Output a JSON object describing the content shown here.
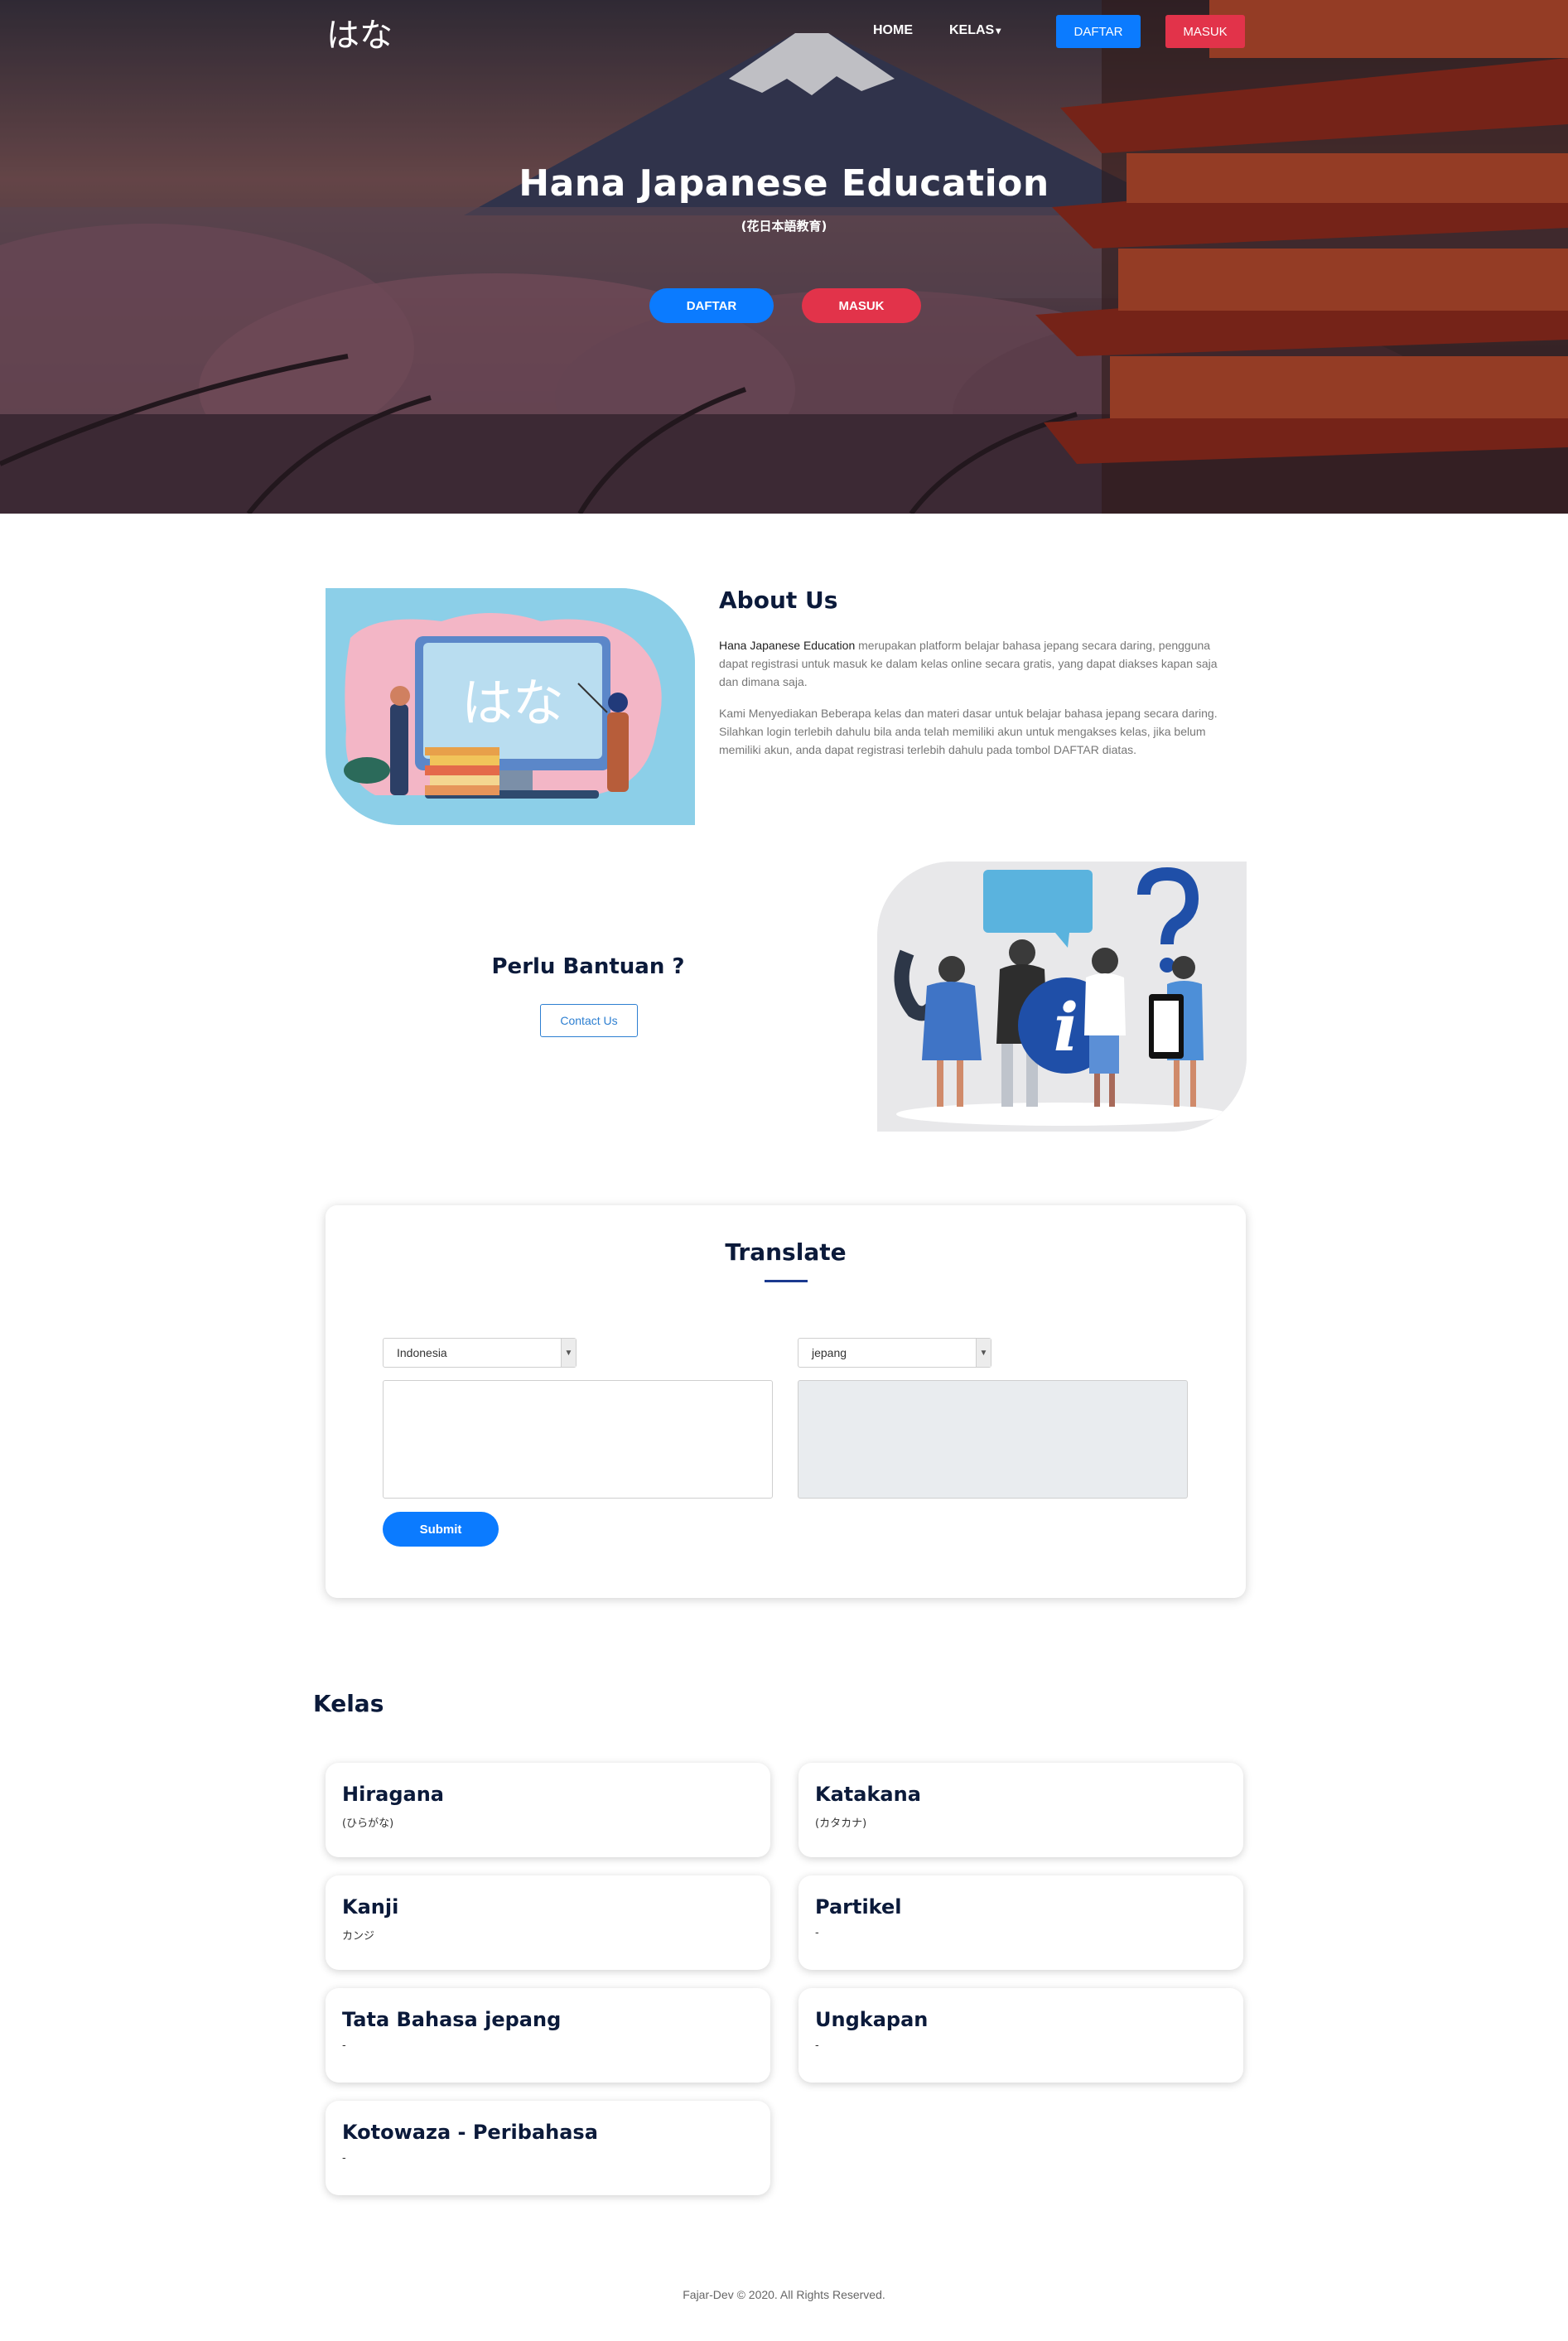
{
  "navbar": {
    "logo": "はな",
    "home": "HOME",
    "kelas": "KELAS",
    "kelas_caret": "▾",
    "daftar": "DAFTAR",
    "masuk": "MASUK"
  },
  "hero": {
    "title": "Hana Japanese Education",
    "subtitle": "(花日本語教育)",
    "daftar": "DAFTAR",
    "masuk": "MASUK"
  },
  "about": {
    "title": "About Us",
    "brand": "Hana Japanese Education",
    "p1_rest": " merupakan platform belajar bahasa jepang secara daring, pengguna dapat registrasi untuk masuk ke dalam kelas online secara gratis, yang dapat diakses kapan saja dan dimana saja.",
    "p2": "Kami Menyediakan Beberapa kelas dan materi dasar untuk belajar bahasa jepang secara daring. Silahkan login terlebih dahulu bila anda telah memiliki akun untuk mengakses kelas, jika belum memiliki akun, anda dapat registrasi terlebih dahulu pada tombol DAFTAR diatas.",
    "image_text": "はな"
  },
  "help": {
    "title": "Perlu Bantuan ?",
    "button": "Contact Us"
  },
  "translate": {
    "title": "Translate",
    "source_lang": "Indonesia",
    "target_lang": "jepang",
    "source_text": "",
    "target_text": "",
    "submit": "Submit"
  },
  "kelas": {
    "heading": "Kelas",
    "items": [
      {
        "title": "Hiragana",
        "subtitle": "(ひらがな)"
      },
      {
        "title": "Katakana",
        "subtitle": "(カタカナ)"
      },
      {
        "title": "Kanji",
        "subtitle": "カンジ"
      },
      {
        "title": "Partikel",
        "subtitle": "-"
      },
      {
        "title": "Tata Bahasa jepang",
        "subtitle": "-"
      },
      {
        "title": "Ungkapan",
        "subtitle": "-"
      },
      {
        "title": "Kotowaza - Peribahasa",
        "subtitle": "-"
      }
    ]
  },
  "footer": {
    "text": "Fajar-Dev © 2020. All Rights Reserved."
  },
  "colors": {
    "primary": "#0b7bff",
    "danger": "#e2334a",
    "heading": "#0b1a3a",
    "accent_line": "#1b3a8f",
    "outline": "#2d7fd1"
  },
  "icons": {
    "kelas_dropdown": "caret-down-icon",
    "select_arrow": "chevron-down-icon"
  }
}
